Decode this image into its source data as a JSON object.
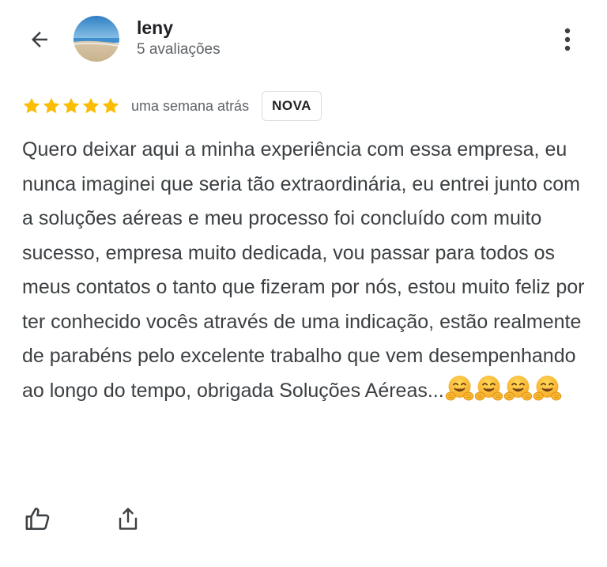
{
  "header": {
    "back_icon": "arrow-back-icon",
    "user_name": "leny",
    "review_count": "5 avaliações",
    "more_icon": "more-vert-icon"
  },
  "review": {
    "rating": 5,
    "rating_max": 5,
    "timestamp": "uma semana atrás",
    "badge": "NOVA",
    "text": "Quero deixar aqui a minha experiência com essa empresa, eu nunca imaginei que seria tão extraordinária, eu entrei junto com a soluções aéreas e meu processo foi concluído com muito sucesso, empresa muito dedicada, vou passar para todos os meus contatos o tanto que fizeram por nós, estou muito feliz por ter conhecido vocês através de uma indicação, estão realmente de parabéns pelo excelente trabalho que vem desempenhando ao longo do tempo, obrigada Soluções Aéreas...",
    "trailing_emoji": "🤗🤗🤗🤗"
  },
  "actions": {
    "like_icon": "thumb-up-icon",
    "share_icon": "share-icon"
  },
  "colors": {
    "star": "#fbbc04",
    "text_primary": "#202124",
    "text_secondary": "#5f6368",
    "badge_border": "#dadce0"
  }
}
